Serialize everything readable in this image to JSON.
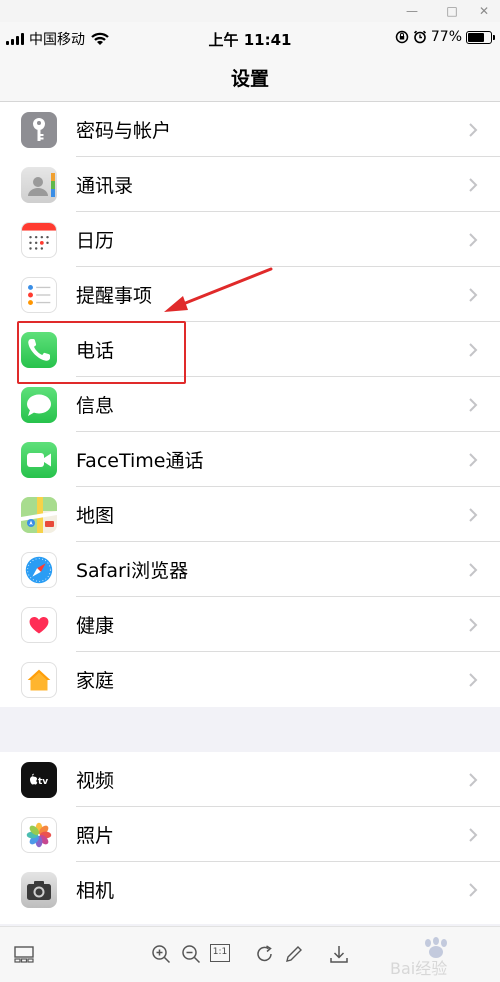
{
  "status_bar": {
    "carrier": "中国移动",
    "time": "上午 11:41",
    "battery_percent": "77%",
    "battery_level": 0.77
  },
  "nav": {
    "title": "设置"
  },
  "group1": [
    {
      "label": "密码与帐户",
      "icon": "key-icon",
      "color": "#8e8e93"
    },
    {
      "label": "通讯录",
      "icon": "contacts-icon",
      "color": "#d9d9d9"
    },
    {
      "label": "日历",
      "icon": "calendar-icon",
      "color": "#ffffff"
    },
    {
      "label": "提醒事项",
      "icon": "reminders-icon",
      "color": "#ffffff"
    },
    {
      "label": "电话",
      "icon": "phone-icon",
      "color": "#34c759"
    },
    {
      "label": "信息",
      "icon": "messages-icon",
      "color": "#34c759"
    },
    {
      "label": "FaceTime通话",
      "icon": "facetime-icon",
      "color": "#34c759"
    },
    {
      "label": "地图",
      "icon": "maps-icon",
      "color": "#a8dc8e"
    },
    {
      "label": "Safari浏览器",
      "icon": "safari-icon",
      "color": "#1e8cf0"
    },
    {
      "label": "健康",
      "icon": "health-icon",
      "color": "#ffffff"
    },
    {
      "label": "家庭",
      "icon": "home-icon",
      "color": "#ffffff"
    }
  ],
  "group2": [
    {
      "label": "视频",
      "icon": "appletv-icon",
      "color": "#111111"
    },
    {
      "label": "照片",
      "icon": "photos-icon",
      "color": "#ffffff"
    },
    {
      "label": "相机",
      "icon": "camera-icon",
      "color": "#d0d0d0"
    }
  ],
  "annotation": {
    "highlight_color": "#e02a2a"
  },
  "toolbar": {
    "actual_size_label": "1:1",
    "watermark_text": "Bai经验"
  }
}
